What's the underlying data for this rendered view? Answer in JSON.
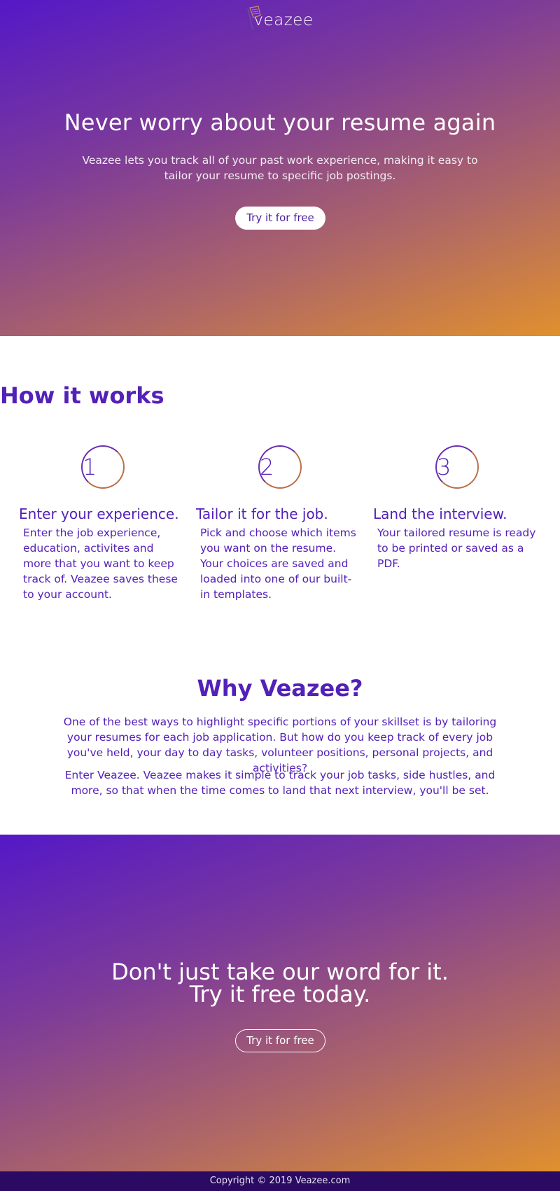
{
  "brand": {
    "name": "veazee",
    "logo_icon": "pencil-paper-icon"
  },
  "hero": {
    "title": "Never worry about your resume again",
    "subtitle": "Veazee lets you track all of your past work experience, making it easy to tailor your resume to specific job postings.",
    "cta_label": "Try it for free"
  },
  "how": {
    "title": "How it works",
    "steps": [
      {
        "number": "1",
        "title": "Enter your experience.",
        "text": "Enter the job experience, education, activites and more that you want to keep track of. Veazee saves these to your account."
      },
      {
        "number": "2",
        "title": "Tailor it for the job.",
        "text": "Pick and choose which items you want on the resume. Your choices are saved and loaded into one of our built-in templates."
      },
      {
        "number": "3",
        "title": "Land the interview.",
        "text": "Your tailored resume is ready to be printed or saved as a PDF."
      }
    ]
  },
  "why": {
    "title": "Why Veazee?",
    "paragraphs": [
      "One of the best ways to highlight specific portions of your skillset is by tailoring your resumes for each job application. But how do you keep track of every job you've held, your day to day tasks, volunteer positions, personal projects, and activities?",
      "Enter Veazee. Veazee makes it simple to track your job tasks, side hustles, and more, so that when the time comes to land that next interview, you'll be set."
    ]
  },
  "cta": {
    "line1": "Don't just take our word for it.",
    "line2": "Try it free today.",
    "button_label": "Try it for free"
  },
  "footer": {
    "copyright": "Copyright © 2019 Veazee.com"
  },
  "colors": {
    "primary": "#5320b8",
    "gradient_start": "#5418c7",
    "gradient_end": "#e0902e",
    "footer_bg": "#2a0a63"
  }
}
